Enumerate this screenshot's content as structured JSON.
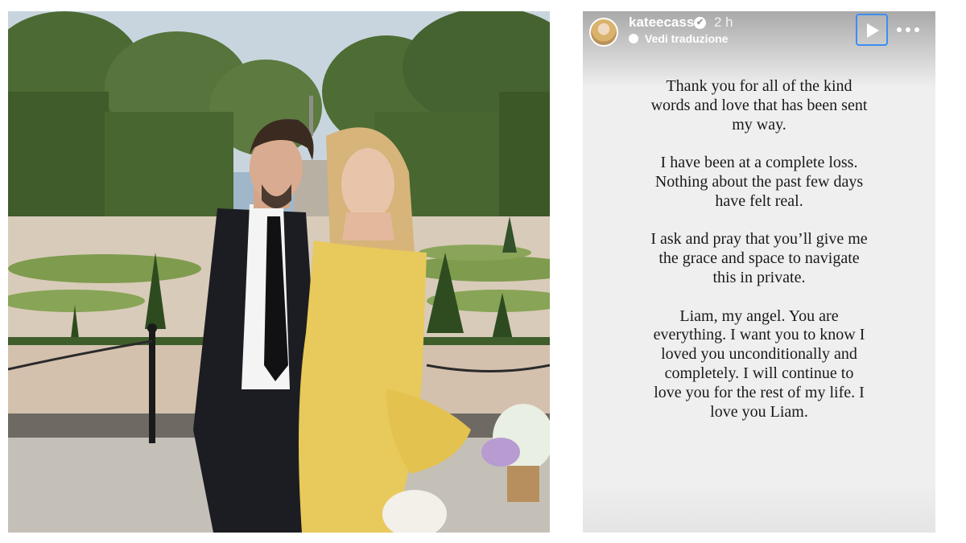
{
  "photo": {
    "alt_subject": "couple-photo",
    "colors": {
      "sky": "#c7d3dd",
      "hedge": "#3f5a2c",
      "dress": "#e9c85a",
      "suit": "#1c1d22",
      "gravel": "#cdb9a6"
    }
  },
  "story": {
    "username": "kateecass",
    "verified_mark": "✔",
    "timestamp": "2 h",
    "translate_label": "Vedi traduzione",
    "text": [
      "Thank you for all of the kind words and love that has been sent my way.",
      "I have been at a complete loss. Nothing about the past few days have felt real.",
      "I ask and pray that you’ll give me the grace and space to navigate this in private.",
      "Liam, my angel. You are everything. I want you to know I loved you unconditionally and completely. I will continue to love you for the rest of my life. I love you Liam."
    ],
    "icons": {
      "play": "play-icon",
      "more": "more-options-icon",
      "translate": "translate-icon",
      "verified": "verified-icon"
    },
    "accent_color": "#3b8ff0"
  }
}
